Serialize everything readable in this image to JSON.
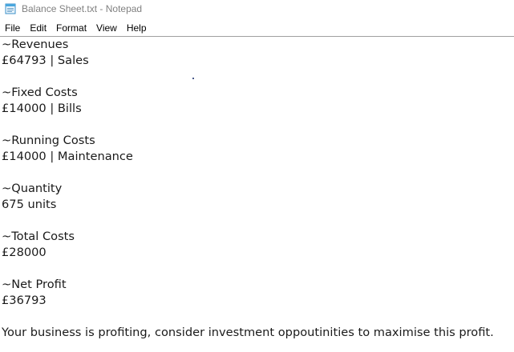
{
  "window": {
    "title": "Balance Sheet.txt - Notepad",
    "icon": "notepad-icon"
  },
  "menu": {
    "items": [
      "File",
      "Edit",
      "Format",
      "View",
      "Help"
    ]
  },
  "document": {
    "lines": [
      "~Revenues",
      "£64793 | Sales",
      "",
      "~Fixed Costs",
      "£14000 | Bills",
      "",
      "~Running Costs",
      "£14000 | Maintenance",
      "",
      "~Quantity",
      "675 units",
      "",
      "~Total Costs",
      "£28000",
      "",
      "~Net Profit",
      "£36793",
      "",
      "Your business is profiting, consider investment oppoutinities to maximise this profit."
    ]
  }
}
